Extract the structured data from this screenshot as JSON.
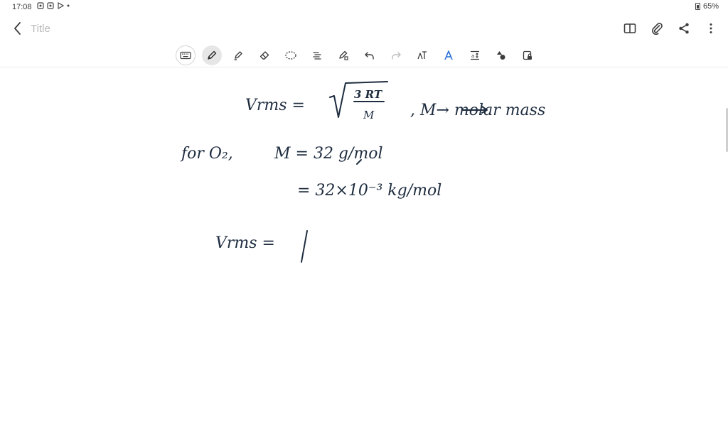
{
  "status_bar": {
    "time": "17:08",
    "battery_percent": "65%"
  },
  "title_bar": {
    "title_placeholder": "Title"
  },
  "toolbar": {
    "tools": [
      "keyboard-icon",
      "pen-icon",
      "highlighter-icon",
      "eraser-icon",
      "lasso-icon",
      "text-box-icon",
      "shape-icon",
      "undo-icon",
      "redo-icon",
      "handwriting-to-text-icon",
      "pen-color-icon",
      "spacing-icon",
      "insert-shape-icon",
      "read-only-lock-icon"
    ],
    "active_tool": "pen-icon"
  },
  "handwriting": {
    "line1_lhs": "Vrms =",
    "line1_numerator": "3 RT",
    "line1_denominator": "M",
    "line1_note": ", M→ molar mass",
    "line2_label": "for O₂,",
    "line2_expr": "M =  32 g/mol",
    "line3_expr": "=  32×10⁻³ kg/mol",
    "line4_lhs": "Vrms ="
  },
  "colors": {
    "ink": "#1e2c3f",
    "icon": "#3d3d3d",
    "accent": "#2b6fd6"
  }
}
